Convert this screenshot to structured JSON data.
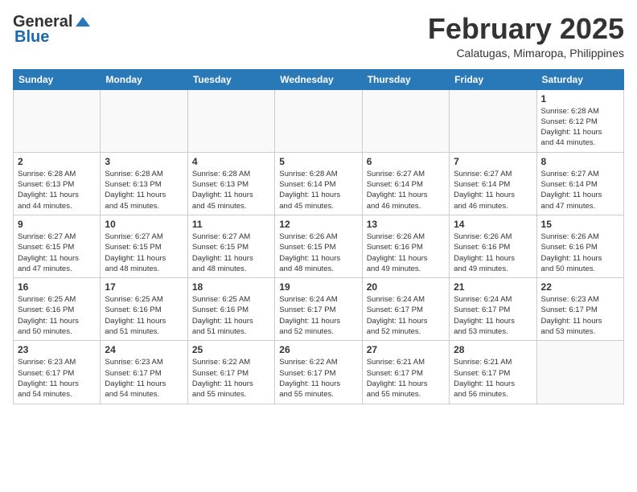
{
  "header": {
    "logo_general": "General",
    "logo_blue": "Blue",
    "month_year": "February 2025",
    "location": "Calatugas, Mimaropa, Philippines"
  },
  "calendar": {
    "days_of_week": [
      "Sunday",
      "Monday",
      "Tuesday",
      "Wednesday",
      "Thursday",
      "Friday",
      "Saturday"
    ],
    "weeks": [
      [
        {
          "day": "",
          "info": ""
        },
        {
          "day": "",
          "info": ""
        },
        {
          "day": "",
          "info": ""
        },
        {
          "day": "",
          "info": ""
        },
        {
          "day": "",
          "info": ""
        },
        {
          "day": "",
          "info": ""
        },
        {
          "day": "1",
          "info": "Sunrise: 6:28 AM\nSunset: 6:12 PM\nDaylight: 11 hours\nand 44 minutes."
        }
      ],
      [
        {
          "day": "2",
          "info": "Sunrise: 6:28 AM\nSunset: 6:13 PM\nDaylight: 11 hours\nand 44 minutes."
        },
        {
          "day": "3",
          "info": "Sunrise: 6:28 AM\nSunset: 6:13 PM\nDaylight: 11 hours\nand 45 minutes."
        },
        {
          "day": "4",
          "info": "Sunrise: 6:28 AM\nSunset: 6:13 PM\nDaylight: 11 hours\nand 45 minutes."
        },
        {
          "day": "5",
          "info": "Sunrise: 6:28 AM\nSunset: 6:14 PM\nDaylight: 11 hours\nand 45 minutes."
        },
        {
          "day": "6",
          "info": "Sunrise: 6:27 AM\nSunset: 6:14 PM\nDaylight: 11 hours\nand 46 minutes."
        },
        {
          "day": "7",
          "info": "Sunrise: 6:27 AM\nSunset: 6:14 PM\nDaylight: 11 hours\nand 46 minutes."
        },
        {
          "day": "8",
          "info": "Sunrise: 6:27 AM\nSunset: 6:14 PM\nDaylight: 11 hours\nand 47 minutes."
        }
      ],
      [
        {
          "day": "9",
          "info": "Sunrise: 6:27 AM\nSunset: 6:15 PM\nDaylight: 11 hours\nand 47 minutes."
        },
        {
          "day": "10",
          "info": "Sunrise: 6:27 AM\nSunset: 6:15 PM\nDaylight: 11 hours\nand 48 minutes."
        },
        {
          "day": "11",
          "info": "Sunrise: 6:27 AM\nSunset: 6:15 PM\nDaylight: 11 hours\nand 48 minutes."
        },
        {
          "day": "12",
          "info": "Sunrise: 6:26 AM\nSunset: 6:15 PM\nDaylight: 11 hours\nand 48 minutes."
        },
        {
          "day": "13",
          "info": "Sunrise: 6:26 AM\nSunset: 6:16 PM\nDaylight: 11 hours\nand 49 minutes."
        },
        {
          "day": "14",
          "info": "Sunrise: 6:26 AM\nSunset: 6:16 PM\nDaylight: 11 hours\nand 49 minutes."
        },
        {
          "day": "15",
          "info": "Sunrise: 6:26 AM\nSunset: 6:16 PM\nDaylight: 11 hours\nand 50 minutes."
        }
      ],
      [
        {
          "day": "16",
          "info": "Sunrise: 6:25 AM\nSunset: 6:16 PM\nDaylight: 11 hours\nand 50 minutes."
        },
        {
          "day": "17",
          "info": "Sunrise: 6:25 AM\nSunset: 6:16 PM\nDaylight: 11 hours\nand 51 minutes."
        },
        {
          "day": "18",
          "info": "Sunrise: 6:25 AM\nSunset: 6:16 PM\nDaylight: 11 hours\nand 51 minutes."
        },
        {
          "day": "19",
          "info": "Sunrise: 6:24 AM\nSunset: 6:17 PM\nDaylight: 11 hours\nand 52 minutes."
        },
        {
          "day": "20",
          "info": "Sunrise: 6:24 AM\nSunset: 6:17 PM\nDaylight: 11 hours\nand 52 minutes."
        },
        {
          "day": "21",
          "info": "Sunrise: 6:24 AM\nSunset: 6:17 PM\nDaylight: 11 hours\nand 53 minutes."
        },
        {
          "day": "22",
          "info": "Sunrise: 6:23 AM\nSunset: 6:17 PM\nDaylight: 11 hours\nand 53 minutes."
        }
      ],
      [
        {
          "day": "23",
          "info": "Sunrise: 6:23 AM\nSunset: 6:17 PM\nDaylight: 11 hours\nand 54 minutes."
        },
        {
          "day": "24",
          "info": "Sunrise: 6:23 AM\nSunset: 6:17 PM\nDaylight: 11 hours\nand 54 minutes."
        },
        {
          "day": "25",
          "info": "Sunrise: 6:22 AM\nSunset: 6:17 PM\nDaylight: 11 hours\nand 55 minutes."
        },
        {
          "day": "26",
          "info": "Sunrise: 6:22 AM\nSunset: 6:17 PM\nDaylight: 11 hours\nand 55 minutes."
        },
        {
          "day": "27",
          "info": "Sunrise: 6:21 AM\nSunset: 6:17 PM\nDaylight: 11 hours\nand 55 minutes."
        },
        {
          "day": "28",
          "info": "Sunrise: 6:21 AM\nSunset: 6:17 PM\nDaylight: 11 hours\nand 56 minutes."
        },
        {
          "day": "",
          "info": ""
        }
      ]
    ]
  }
}
